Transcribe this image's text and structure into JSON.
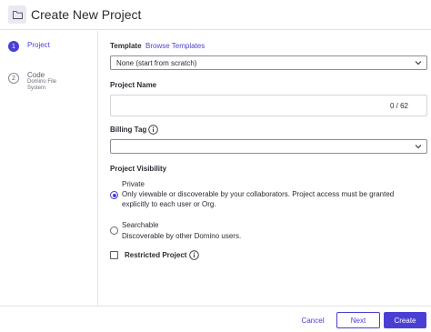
{
  "header": {
    "title": "Create New Project",
    "icon": "folder-icon"
  },
  "stepper": {
    "steps": [
      {
        "number": "1",
        "label": "Project",
        "sublabel": ""
      },
      {
        "number": "2",
        "label": "Code",
        "sublabel": "Domino File System"
      }
    ]
  },
  "form": {
    "template": {
      "label": "Template",
      "link": "Browse Templates",
      "value": "None (start from scratch)"
    },
    "project_name": {
      "label": "Project Name",
      "value": "",
      "counter": "0 / 62"
    },
    "billing_tag": {
      "label": "Billing Tag",
      "value": ""
    },
    "visibility": {
      "label": "Project Visibility",
      "options": [
        {
          "title": "Private",
          "desc_line1": "Only viewable or discoverable by your collaborators. Project access must be granted",
          "desc_line2": "explicitly to each user or Org.",
          "selected": true
        },
        {
          "title": "Searchable",
          "desc_line1": "Discoverable by other Domino users.",
          "desc_line2": "",
          "selected": false
        }
      ]
    },
    "restricted": {
      "label": "Restricted Project",
      "checked": false
    }
  },
  "footer": {
    "cancel": "Cancel",
    "next": "Next",
    "create": "Create"
  },
  "colors": {
    "accent": "#4b3fd3",
    "border": "#e3e3e6"
  }
}
